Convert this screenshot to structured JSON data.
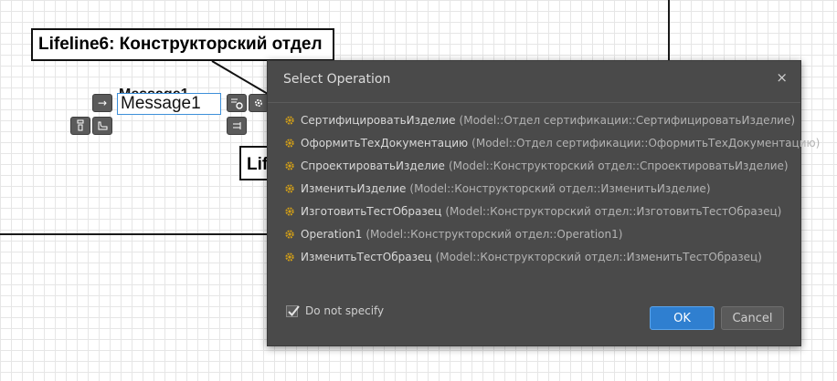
{
  "canvas": {
    "lifeline_top_label": "Lifeline6: Конструкторский отдел",
    "lifeline_bottom_label": "Lifeline",
    "message_value": "Message1",
    "message_behind": "Message1"
  },
  "dialog": {
    "title": "Select Operation",
    "close_glyph": "×",
    "operations": [
      {
        "name": "СертифицироватьИзделие",
        "qualified": "(Model::Отдел сертификации::СертифицироватьИзделие)"
      },
      {
        "name": "ОформитьТехДокументацию",
        "qualified": "(Model::Отдел сертификации::ОформитьТехДокументацию)"
      },
      {
        "name": "СпроектироватьИзделие",
        "qualified": "(Model::Конструкторский отдел::СпроектироватьИзделие)"
      },
      {
        "name": "ИзменитьИзделие",
        "qualified": "(Model::Конструкторский отдел::ИзменитьИзделие)"
      },
      {
        "name": "ИзготовитьТестОбразец",
        "qualified": "(Model::Конструкторский отдел::ИзготовитьТестОбразец)"
      },
      {
        "name": "Operation1",
        "qualified": "(Model::Конструкторский отдел::Operation1)"
      },
      {
        "name": "ИзменитьТестОбразец",
        "qualified": "(Model::Конструкторский отдел::ИзменитьТестОбразец)"
      }
    ],
    "do_not_specify_label": "Do not specify",
    "do_not_specify_checked": true,
    "ok_label": "OK",
    "cancel_label": "Cancel"
  },
  "colors": {
    "dialog_bg": "#4a4a4a",
    "ok_button": "#2f7fd0",
    "operation_icon": "#d4a017"
  }
}
